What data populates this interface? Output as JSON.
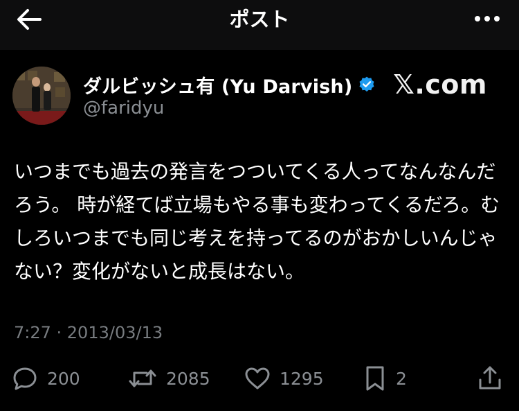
{
  "header": {
    "title": "ポスト"
  },
  "author": {
    "display_name": "ダルビッシュ有 (Yu Darvish)",
    "handle": "@faridyu",
    "verified": true
  },
  "brand": {
    "x_mark": "𝕏",
    "domain": ".com"
  },
  "tweet": {
    "text": "いつまでも過去の発言をつついてくる人ってなんなんだろう。 時が経てば立場もやる事も変わってくるだろ。むしろいつまでも同じ考えを持ってるのがおかしいんじゃない？変化がないと成長はない。",
    "timestamp": "7:27 · 2013/03/13"
  },
  "actions": {
    "reply_count": "200",
    "repost_count": "2085",
    "like_count": "1295",
    "bookmark_count": "2"
  },
  "icons": {
    "back": "back-arrow-icon",
    "more": "more-icon",
    "verified": "verified-badge-icon",
    "reply": "reply-icon",
    "repost": "repost-icon",
    "like": "like-icon",
    "bookmark": "bookmark-icon",
    "share": "share-icon"
  },
  "colors": {
    "background": "#000000",
    "header_background": "#0d0d0e",
    "text": "#ffffff",
    "secondary_text": "#8b8f94",
    "verified_blue": "#1d9bf0"
  }
}
